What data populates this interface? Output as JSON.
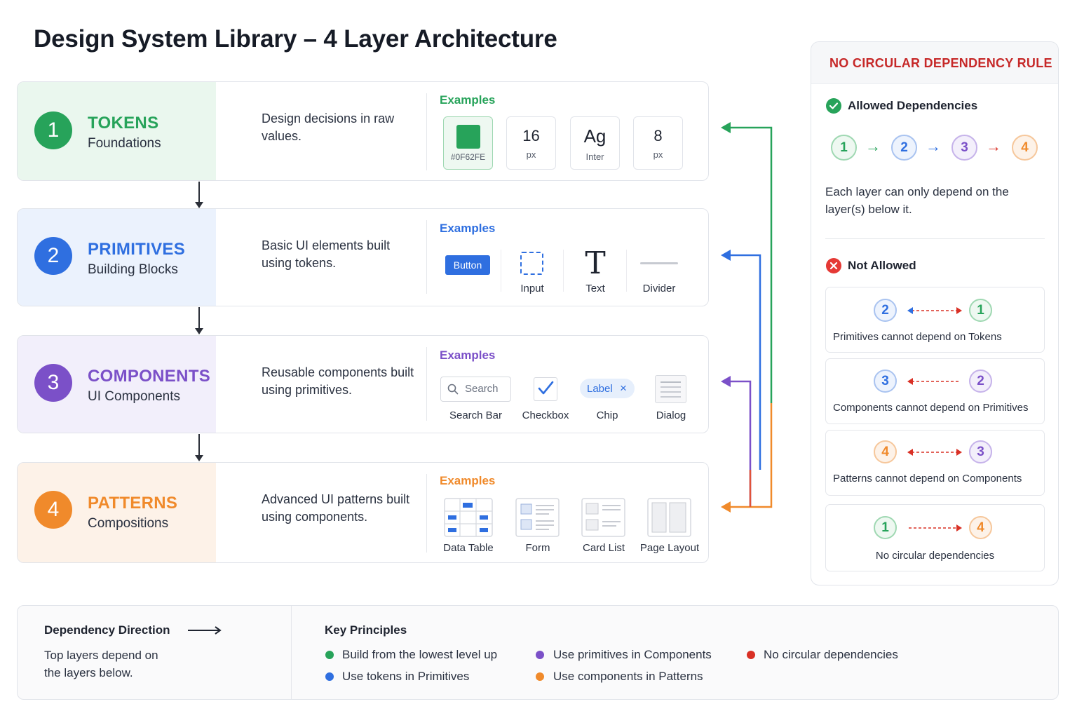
{
  "title": "Design System Library – 4 Layer Architecture",
  "colors": {
    "tokens": "#27a35a",
    "primitives": "#2f6fe0",
    "components": "#7b50c8",
    "patterns": "#f08a2b",
    "danger": "#d93025"
  },
  "layers": [
    {
      "number": "1",
      "name": "TOKENS",
      "subtitle": "Foundations",
      "description": "Design decisions in raw values.",
      "examples_title": "Examples",
      "examples": [
        {
          "value": "",
          "label": "#0F62FE",
          "icon": "color-swatch-icon"
        },
        {
          "value": "16",
          "label": "px"
        },
        {
          "value": "Ag",
          "label": "Inter"
        },
        {
          "value": "8",
          "label": "px"
        }
      ]
    },
    {
      "number": "2",
      "name": "PRIMITIVES",
      "subtitle": "Building Blocks",
      "description": "Basic UI elements built using tokens.",
      "examples_title": "Examples",
      "examples": [
        {
          "label": "Button"
        },
        {
          "label": "Input",
          "icon": "dashed-box-icon"
        },
        {
          "label": "Text",
          "glyph": "T"
        },
        {
          "label": "Divider",
          "icon": "divider-line-icon"
        }
      ]
    },
    {
      "number": "3",
      "name": "COMPONENTS",
      "subtitle": "UI Components",
      "description": "Reusable components built using primitives.",
      "examples_title": "Examples",
      "examples": [
        {
          "label": "Search Bar",
          "placeholder": "Search"
        },
        {
          "label": "Checkbox",
          "icon": "checkmark-icon"
        },
        {
          "label": "Chip",
          "chip_text": "Label",
          "close": "×"
        },
        {
          "label": "Dialog",
          "icon": "dialog-icon"
        }
      ]
    },
    {
      "number": "4",
      "name": "PATTERNS",
      "subtitle": "Compositions",
      "description": "Advanced UI patterns built using components.",
      "examples_title": "Examples",
      "examples": [
        {
          "label": "Data Table",
          "icon": "data-table-icon"
        },
        {
          "label": "Form",
          "icon": "form-icon"
        },
        {
          "label": "Card List",
          "icon": "card-list-icon"
        },
        {
          "label": "Page Layout",
          "icon": "page-layout-icon"
        }
      ]
    }
  ],
  "rule_panel": {
    "title": "NO CIRCULAR DEPENDENCY RULE",
    "allowed_title": "Allowed Dependencies",
    "allowed_chain": [
      "1",
      "2",
      "3",
      "4"
    ],
    "allowed_text": "Each layer can only depend on the layer(s) below it.",
    "not_allowed_title": "Not Allowed",
    "rules": [
      {
        "from": "2",
        "to": "1",
        "text": "Primitives cannot depend on Tokens"
      },
      {
        "from": "3",
        "to": "2",
        "text": "Components cannot depend on Primitives"
      },
      {
        "from": "4",
        "to": "3",
        "text": "Patterns cannot depend on Components"
      },
      {
        "from": "1",
        "to": "4",
        "text": "No circular dependencies"
      }
    ]
  },
  "footer": {
    "direction_title": "Dependency Direction",
    "direction_text": "Top layers depend on the layers below.",
    "principles_title": "Key Principles",
    "principles": [
      {
        "text": "Build from the lowest level up",
        "color": "#27a35a"
      },
      {
        "text": "Use tokens in Primitives",
        "color": "#2f6fe0"
      },
      {
        "text": "Use primitives in Components",
        "color": "#7b50c8"
      },
      {
        "text": "Use components in Patterns",
        "color": "#f08a2b"
      },
      {
        "text": "No circular dependencies",
        "color": "#d93025"
      }
    ]
  }
}
